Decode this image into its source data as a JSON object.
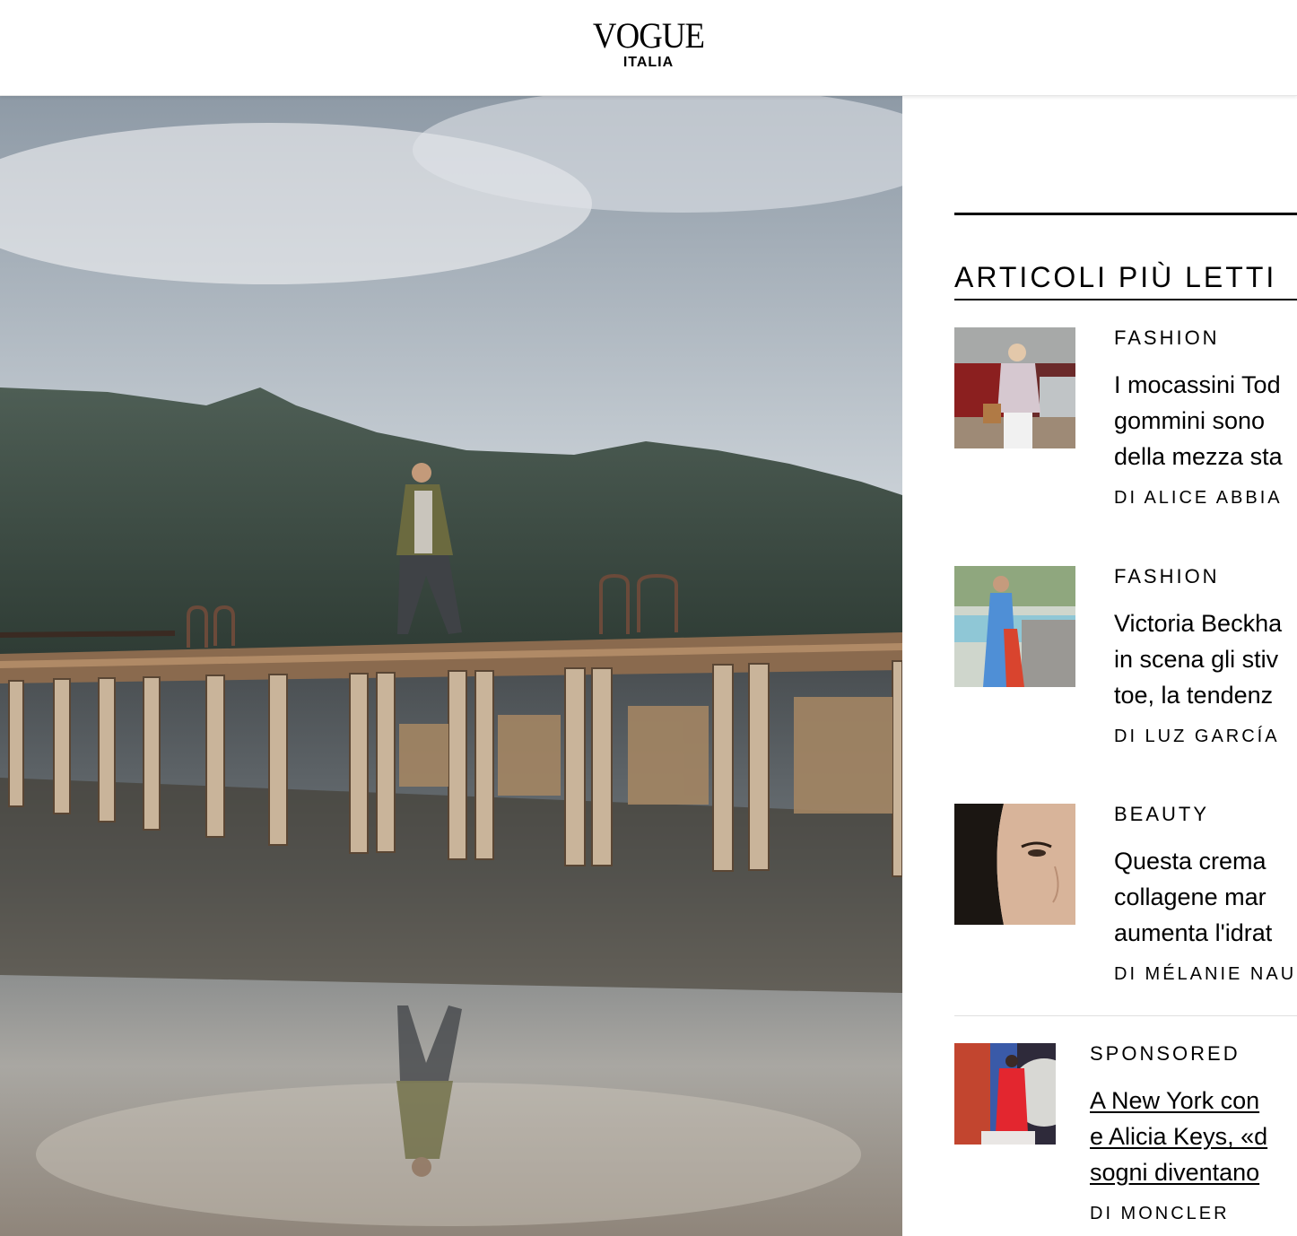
{
  "header": {
    "logo_main": "VOGUE",
    "logo_sub": "ITALIA"
  },
  "hero": {
    "image": "man-walking-on-wooden-pier-lake-reflection"
  },
  "sidebar": {
    "title": "ARTICOLI PIÙ LETTI",
    "articles": [
      {
        "rubric": "FASHION",
        "lines": [
          "I mocassini Tod",
          "gommini sono",
          "della mezza sta"
        ],
        "byline": "DI ALICE ABBIA"
      },
      {
        "rubric": "FASHION",
        "lines": [
          "Victoria Beckha",
          "in scena gli stiv",
          "toe, la tendenz"
        ],
        "byline": "DI LUZ GARCÍA"
      },
      {
        "rubric": "BEAUTY",
        "lines": [
          "Questa crema",
          "collagene mar",
          "aumenta l'idrat"
        ],
        "byline": "DI MÉLANIE NAU"
      },
      {
        "rubric": "SPONSORED",
        "lines": [
          "A New York con",
          "e Alicia Keys, «d",
          "sogni diventano"
        ],
        "byline": "DI MONCLER"
      }
    ]
  },
  "colors": {
    "accent": "#000000",
    "background": "#ffffff"
  }
}
